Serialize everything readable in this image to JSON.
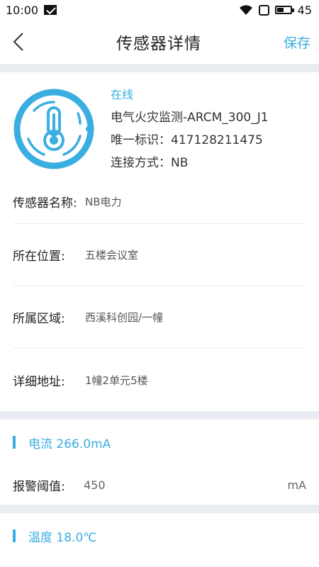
{
  "status_bar": {
    "time": "10:00",
    "battery": "45"
  },
  "nav": {
    "title": "传感器详情",
    "save_label": "保存"
  },
  "sensor": {
    "status": "在线",
    "model": "电气火灾监测-ARCM_300_J1",
    "uid_label": "唯一标识：",
    "uid": "417128211475",
    "conn_label": "连接方式：",
    "conn": "NB"
  },
  "fields": [
    {
      "label": "传感器名称:",
      "value": "NB电力"
    },
    {
      "label": "所在位置:",
      "value": "五楼会议室"
    },
    {
      "label": "所属区域:",
      "value": "西溪科创园/一幢"
    },
    {
      "label": "详细地址:",
      "value": "1幢2单元5楼"
    }
  ],
  "sections": [
    {
      "title": "电流 266.0mA",
      "threshold_label": "报警阈值:",
      "threshold_value": "450",
      "unit": "mA"
    },
    {
      "title": "温度 18.0℃"
    }
  ],
  "colors": {
    "accent": "#3aaee0",
    "section_gap": "#e9edf1"
  },
  "icons": {
    "sensor": "thermometer-icon",
    "back": "chevron-left-icon"
  }
}
